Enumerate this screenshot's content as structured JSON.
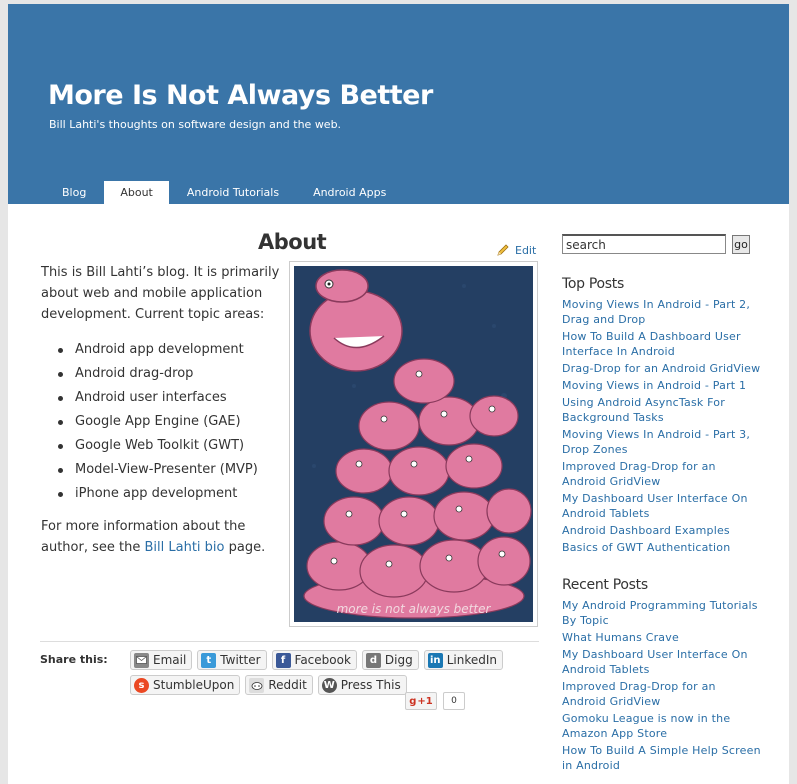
{
  "site": {
    "title": "More Is Not Always Better",
    "description": "Bill Lahti's thoughts on software design and the web."
  },
  "nav": {
    "items": [
      {
        "label": "Blog",
        "active": false
      },
      {
        "label": "About",
        "active": true
      },
      {
        "label": "Android Tutorials",
        "active": false
      },
      {
        "label": "Android Apps",
        "active": false
      }
    ]
  },
  "page": {
    "title": "About",
    "edit_label": "Edit",
    "intro": "This is Bill Lahti’s blog. It is primarily about web and mobile application development. Current topic areas:",
    "topics": [
      "Android app development",
      "Android drag-drop",
      "Android user interfaces",
      "Google App Engine (GAE)",
      "Google Web Toolkit (GWT)",
      "Model-View-Presenter (MVP)",
      "iPhone app development"
    ],
    "outro_prefix": "For more information about the author, see the ",
    "outro_link": "Bill Lahti bio",
    "outro_suffix": " page.",
    "photo_caption": "more is not always better"
  },
  "share": {
    "label": "Share this:",
    "buttons": [
      {
        "label": "Email",
        "icon": "email-icon",
        "color": "#888888"
      },
      {
        "label": "Twitter",
        "icon": "twitter-icon",
        "color": "#3a9ad9"
      },
      {
        "label": "Facebook",
        "icon": "facebook-icon",
        "color": "#3b5998"
      },
      {
        "label": "Digg",
        "icon": "digg-icon",
        "color": "#777777"
      },
      {
        "label": "LinkedIn",
        "icon": "linkedin-icon",
        "color": "#1a78b4"
      },
      {
        "label": "StumbleUpon",
        "icon": "stumbleupon-icon",
        "color": "#eb4823"
      },
      {
        "label": "Reddit",
        "icon": "reddit-icon",
        "color": "#999999"
      },
      {
        "label": "Press This",
        "icon": "wordpress-icon",
        "color": "#555555"
      }
    ],
    "gplus_label": "+1",
    "gplus_count": "0"
  },
  "sidebar": {
    "search_value": "search",
    "go_label": "go",
    "top_posts_title": "Top Posts",
    "top_posts": [
      "Moving Views In Android - Part 2, Drag and Drop",
      "How To Build A Dashboard User Interface In Android",
      "Drag-Drop for an Android GridView",
      "Moving Views in Android - Part 1",
      "Using Android AsyncTask For Background Tasks",
      "Moving Views In Android - Part 3, Drop Zones",
      "Improved Drag-Drop for an Android GridView",
      "My Dashboard User Interface On Android Tablets",
      "Android Dashboard Examples",
      "Basics of GWT Authentication"
    ],
    "recent_posts_title": "Recent Posts",
    "recent_posts": [
      "My Android Programming Tutorials By Topic",
      "What Humans Crave",
      "My Dashboard User Interface On Android Tablets",
      "Improved Drag-Drop for an Android GridView",
      "Gomoku League is now in the Amazon App Store",
      "How To Build A Simple Help Screen in Android"
    ]
  },
  "colors": {
    "header": "#3a75a8",
    "link": "#2a6ea6",
    "photo_background": "#243f63",
    "hippo": "#e07aa0"
  }
}
